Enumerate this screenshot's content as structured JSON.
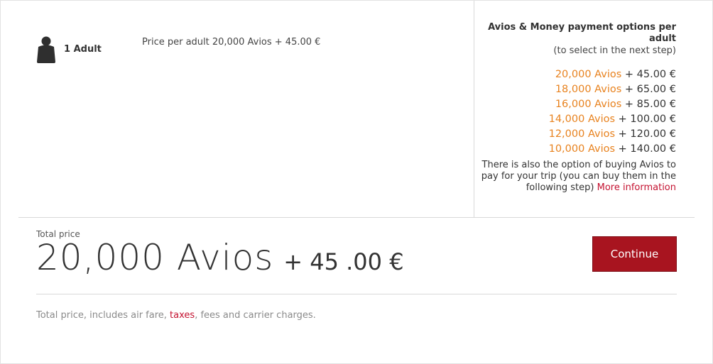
{
  "passenger": {
    "icon": "person-icon",
    "label": "1 Adult",
    "price_per_adult": "Price per adult 20,000 Avios + 45.00 €"
  },
  "payment_options": {
    "title": "Avios & Money payment options per adult",
    "subtitle": "(to select in the next step)",
    "options": [
      {
        "avios": "20,000 Avios",
        "money": " + 45.00 €"
      },
      {
        "avios": "18,000 Avios",
        "money": " + 65.00 €"
      },
      {
        "avios": "16,000 Avios",
        "money": " + 85.00 €"
      },
      {
        "avios": "14,000 Avios",
        "money": " + 100.00 €"
      },
      {
        "avios": "12,000 Avios",
        "money": " + 120.00 €"
      },
      {
        "avios": "10,000 Avios",
        "money": " + 140.00 €"
      }
    ],
    "buy_note": "There is also the option of buying Avios to pay for your trip (you can buy them in the following step) ",
    "more_info_link": "More information"
  },
  "total": {
    "label": "Total price",
    "avios": "20,000 Avios",
    "money": "+ 45 .00 €"
  },
  "continue_button": "Continue",
  "footnote": {
    "prefix": "Total price, includes air fare, ",
    "taxes_link": "taxes",
    "suffix": ", fees and carrier charges."
  },
  "colors": {
    "avios_accent": "#e8821e",
    "link_red": "#c41230",
    "button_red": "#a8141f"
  }
}
